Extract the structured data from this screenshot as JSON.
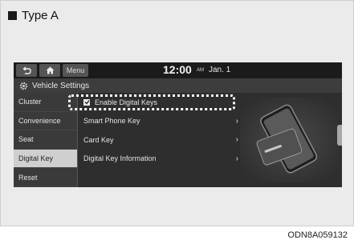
{
  "caption": {
    "label": "Type A"
  },
  "status_bar": {
    "menu_label": "Menu",
    "time": "12:00",
    "ampm": "AM",
    "date": "Jan. 1"
  },
  "title_bar": {
    "title": "Vehicle Settings"
  },
  "sidebar": {
    "items": [
      {
        "label": "Cluster",
        "active": false
      },
      {
        "label": "Convenience",
        "active": false
      },
      {
        "label": "Seat",
        "active": false
      },
      {
        "label": "Digital Key",
        "active": true
      },
      {
        "label": "Reset",
        "active": false
      }
    ]
  },
  "list": {
    "items": [
      {
        "label": "Enable Digital Keys",
        "checked": true
      },
      {
        "label": "Smart Phone Key"
      },
      {
        "label": "Card Key"
      },
      {
        "label": "Digital Key Information"
      }
    ]
  },
  "footer": {
    "code": "ODN8A059132"
  },
  "colors": {
    "screen_bg": "#2e2e2e",
    "sidebar_active": "#cfcfcf",
    "highlight": "#ffffff"
  }
}
